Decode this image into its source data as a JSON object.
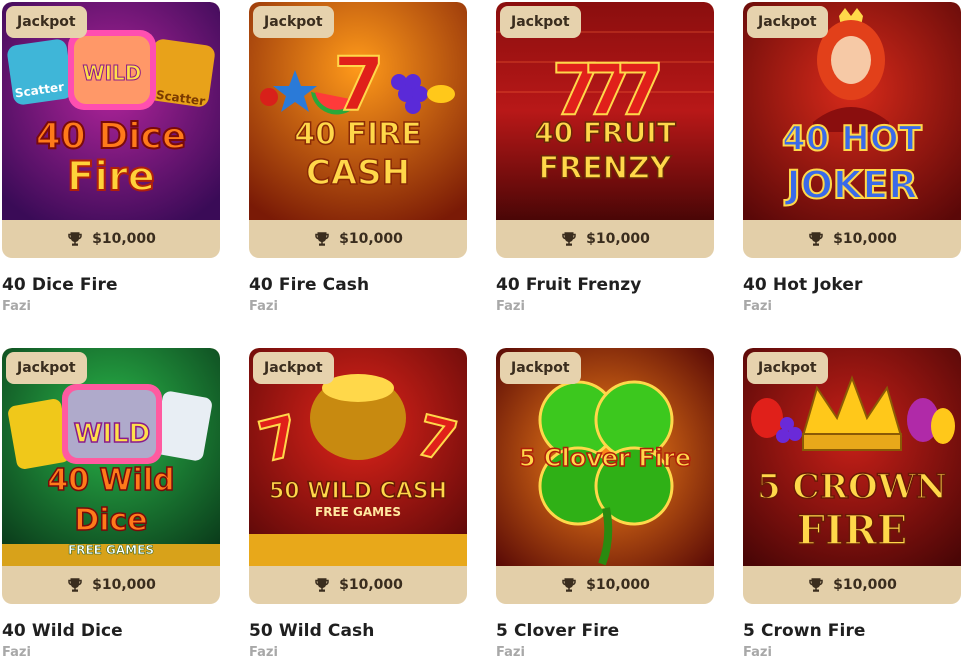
{
  "games": [
    {
      "title": "40 Dice Fire",
      "provider": "Fazi",
      "badge": "Jackpot",
      "prize": "$10,000",
      "art_lines": [
        "40 Dice",
        "Fire"
      ],
      "art_tags": [
        "Scatter",
        "WILD",
        "Scatter"
      ],
      "colors": {
        "bg1": "#7a1c8f",
        "bg2": "#3a0b57",
        "text": "#ff7a1a",
        "accent": "#ffd23a"
      }
    },
    {
      "title": "40 Fire Cash",
      "provider": "Fazi",
      "badge": "Jackpot",
      "prize": "$10,000",
      "art_lines": [
        "40 FIRE",
        "CASH"
      ],
      "colors": {
        "bg1": "#f07a10",
        "bg2": "#7a1a06",
        "text": "#ffd84a",
        "accent": "#e0201a"
      }
    },
    {
      "title": "40 Fruit Frenzy",
      "provider": "Fazi",
      "badge": "Jackpot",
      "prize": "$10,000",
      "art_lines": [
        "40 FRUIT",
        "FRENZY"
      ],
      "colors": {
        "bg1": "#b01818",
        "bg2": "#4a0606",
        "text": "#ffd84a",
        "accent": "#ff4a1a"
      }
    },
    {
      "title": "40 Hot Joker",
      "provider": "Fazi",
      "badge": "Jackpot",
      "prize": "$10,000",
      "art_lines": [
        "40 HOT",
        "JOKER"
      ],
      "colors": {
        "bg1": "#c41a1a",
        "bg2": "#5a0808",
        "text": "#2a5ad8",
        "accent": "#ffd84a"
      }
    },
    {
      "title": "40 Wild Dice",
      "provider": "Fazi",
      "badge": "Jackpot",
      "prize": "$10,000",
      "art_lines": [
        "WILD",
        "40 Wild",
        "Dice",
        "FREE GAMES"
      ],
      "art_tags": [
        "FREE GAMES"
      ],
      "colors": {
        "bg1": "#1a8a3a",
        "bg2": "#0a3a1a",
        "text": "#ff7a1a",
        "accent": "#ffd23a"
      }
    },
    {
      "title": "50 Wild Cash",
      "provider": "Fazi",
      "badge": "Jackpot",
      "prize": "$10,000",
      "art_lines": [
        "50 WILD CASH",
        "FREE GAMES"
      ],
      "colors": {
        "bg1": "#c41a1a",
        "bg2": "#5a0808",
        "text": "#ffd84a",
        "accent": "#ffb020"
      }
    },
    {
      "title": "5 Clover Fire",
      "provider": "Fazi",
      "badge": "Jackpot",
      "prize": "$10,000",
      "art_lines": [
        "5 Clover Fire"
      ],
      "colors": {
        "bg1": "#e2520e",
        "bg2": "#5a0a06",
        "text": "#ffd84a",
        "accent": "#38c81c"
      }
    },
    {
      "title": "5 Crown Fire",
      "provider": "Fazi",
      "badge": "Jackpot",
      "prize": "$10,000",
      "art_lines": [
        "5 CROWN",
        "FIRE"
      ],
      "colors": {
        "bg1": "#b01a1a",
        "bg2": "#4a0606",
        "text": "#ffd84a",
        "accent": "#ffcc33"
      }
    }
  ]
}
